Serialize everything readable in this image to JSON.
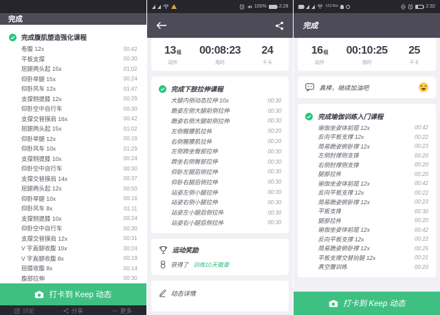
{
  "colors": {
    "accent_green": "#3fc083",
    "check_green": "#23c77d",
    "appbar": "#4e4b59",
    "statusbar": "#26252b",
    "badge_link_green": "#2dbd7c"
  },
  "icons": [
    "check-circle-icon",
    "camera-icon",
    "back-arrow-icon",
    "share-icon",
    "trophy-icon",
    "medal-icon",
    "pencil-icon",
    "speech-bubble-icon",
    "smiley-emoji",
    "alarm-icon",
    "mute-icon",
    "wifi-icon",
    "signal-icon",
    "battery-icon",
    "discuss-icon",
    "more-icon"
  ],
  "screens": {
    "left": {
      "header": {
        "title": "完成"
      },
      "course": {
        "title": "完成腹肌塑造强化课程",
        "items": [
          {
            "name": "卷腹 12x",
            "time": "00:42"
          },
          {
            "name": "平板支撑",
            "time": "00:30"
          },
          {
            "name": "屈腿两头起 15x",
            "time": "01:02"
          },
          {
            "name": "仰卧举腿 15x",
            "time": "00:24"
          },
          {
            "name": "仰卧风车 12x",
            "time": "01:47"
          },
          {
            "name": "支撑侧提膝 12x",
            "time": "00:29"
          },
          {
            "name": "仰卧空中自行车",
            "time": "00:30"
          },
          {
            "name": "支撑交替摸肩 16x",
            "time": "00:42"
          },
          {
            "name": "屈腿两头起 15x",
            "time": "01:02"
          },
          {
            "name": "仰卧举腿 12x",
            "time": "00:19"
          },
          {
            "name": "仰卧风车 10x",
            "time": "01:29"
          },
          {
            "name": "支撑侧提膝 10x",
            "time": "00:24"
          },
          {
            "name": "仰卧空中自行车",
            "time": "00:30"
          },
          {
            "name": "支撑交替摸肩 14x",
            "time": "00:37"
          },
          {
            "name": "屈腿两头起 12x",
            "time": "00:50"
          },
          {
            "name": "仰卧举腿 10x",
            "time": "00:16"
          },
          {
            "name": "仰卧风车 8x",
            "time": "01:11"
          },
          {
            "name": "支撑侧提膝 10x",
            "time": "00:24"
          },
          {
            "name": "仰卧空中自行车",
            "time": "00:30"
          },
          {
            "name": "支撑交替摸肩 12x",
            "time": "00:31"
          },
          {
            "name": "V 字直腿收腹 10x",
            "time": "00:24"
          },
          {
            "name": "V 字直腿收腹 8x",
            "time": "00:19"
          },
          {
            "name": "屈膝收腹 8x",
            "time": "00:14"
          },
          {
            "name": "腹部拉伸",
            "time": "00:30"
          }
        ]
      },
      "button": {
        "label": "打卡到 Keep 动态"
      },
      "toolbar": {
        "discuss": "讨论",
        "share": "分享",
        "more": "更多"
      }
    },
    "middle": {
      "statusbar": {
        "battery": "100%",
        "time": "2:28"
      },
      "stats": [
        {
          "value": "13",
          "unit": "组",
          "label": "动作"
        },
        {
          "value": "00:08:23",
          "unit": "",
          "label": "用时"
        },
        {
          "value": "24",
          "unit": "",
          "label": "千卡"
        }
      ],
      "course": {
        "title": "完成下肢拉伸课程",
        "items": [
          {
            "name": "大腿内侧动态拉伸 10x",
            "time": "00:30"
          },
          {
            "name": "跪姿左侧大腿前侧拉伸",
            "time": "00:30"
          },
          {
            "name": "跪姿右侧大腿前侧拉伸",
            "time": "00:30"
          },
          {
            "name": "左侧髂腰肌拉伸",
            "time": "00:20"
          },
          {
            "name": "右侧髂腰肌拉伸",
            "time": "00:20"
          },
          {
            "name": "左侧跨坐臀部拉伸",
            "time": "00:30"
          },
          {
            "name": "跨坐右侧臀部拉伸",
            "time": "00:30"
          },
          {
            "name": "仰卧左腿后侧拉伸",
            "time": "00:30"
          },
          {
            "name": "仰卧右腿后侧拉伸",
            "time": "00:30"
          },
          {
            "name": "站姿左侧小腿拉伸",
            "time": "00:30"
          },
          {
            "name": "站姿右侧小腿拉伸",
            "time": "00:30"
          },
          {
            "name": "站姿左小腿后侧拉伸",
            "time": "00:30"
          },
          {
            "name": "站姿右小腿后侧拉伸",
            "time": "00:30"
          }
        ]
      },
      "awards": {
        "title": "运动奖励",
        "earned_prefix": "获得了",
        "badge": "训练10天徽章"
      },
      "details": {
        "label": "动态详情"
      }
    },
    "right": {
      "statusbar": {
        "net": "122 B/s",
        "time": "2:32"
      },
      "header": {
        "title": "完成"
      },
      "stats": [
        {
          "value": "16",
          "unit": "组",
          "label": "动作"
        },
        {
          "value": "00:10:25",
          "unit": "",
          "label": "用时"
        },
        {
          "value": "25",
          "unit": "",
          "label": "千卡"
        }
      ],
      "comment": {
        "text": "真棒，继续加油吧"
      },
      "course": {
        "title": "完成瑜伽训练入门课程",
        "items": [
          {
            "name": "瑜伽坐姿体前屈 12x",
            "time": "00:42"
          },
          {
            "name": "反向平板支撑 12x",
            "time": "00:22"
          },
          {
            "name": "简易跪姿俯卧撑 12x",
            "time": "00:23"
          },
          {
            "name": "左侧肘撑侧支撑",
            "time": "00:20"
          },
          {
            "name": "右侧肘撑侧支撑",
            "time": "00:20"
          },
          {
            "name": "腿部拉伸",
            "time": "00:20"
          },
          {
            "name": "瑜伽坐姿体前屈 12x",
            "time": "00:42"
          },
          {
            "name": "反向平板支撑 12x",
            "time": "00:22"
          },
          {
            "name": "简易跪姿俯卧撑 12x",
            "time": "00:23"
          },
          {
            "name": "平板支撑",
            "time": "00:30"
          },
          {
            "name": "腿部拉伸",
            "time": "00:20"
          },
          {
            "name": "瑜伽坐姿体前屈 12x",
            "time": "00:42"
          },
          {
            "name": "反向平板支撑 12x",
            "time": "00:22"
          },
          {
            "name": "简易跪姿俯卧撑 12x",
            "time": "00:25"
          },
          {
            "name": "平板支撑交替抬腿 12x",
            "time": "00:21"
          },
          {
            "name": "真空腹训练",
            "time": "00:20"
          }
        ]
      },
      "button": {
        "label": "打卡到 Keep 动态"
      }
    }
  }
}
